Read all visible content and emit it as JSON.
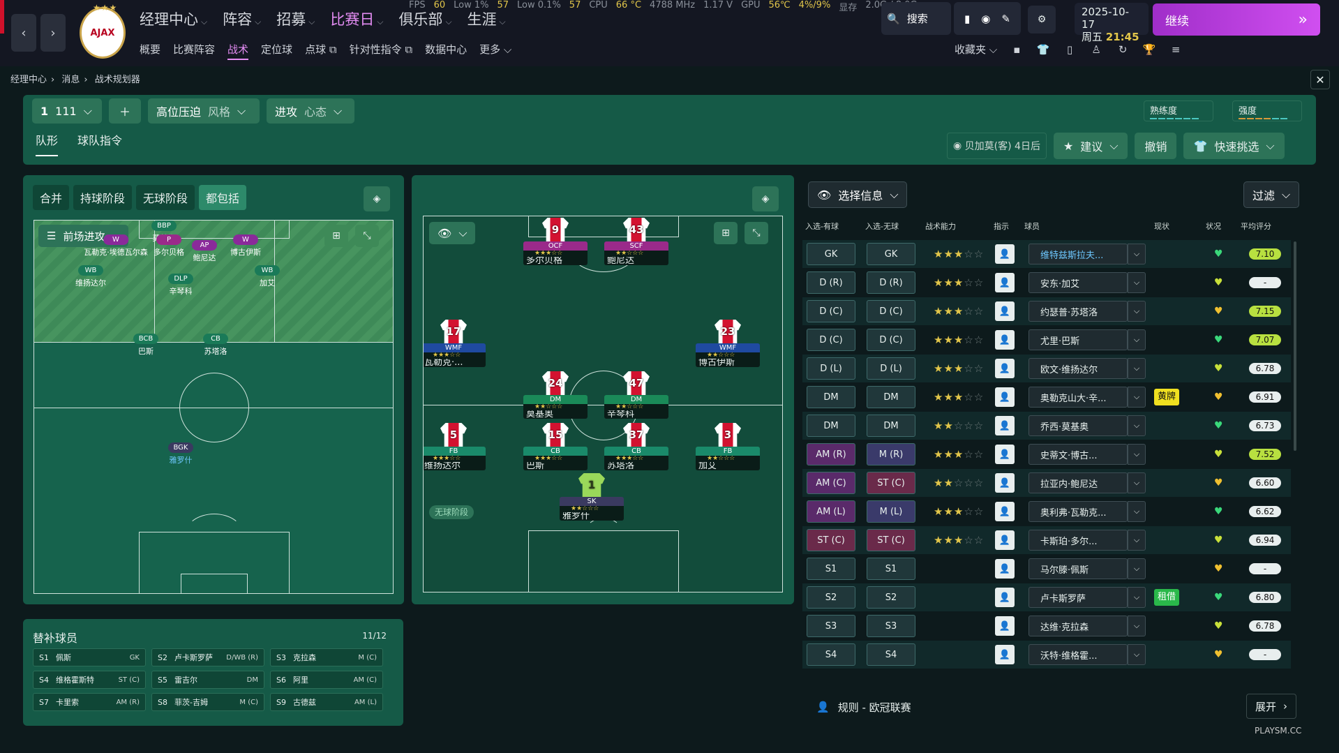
{
  "stats": {
    "fps_label": "FPS",
    "fps": "60",
    "low1_label": "Low 1%",
    "low1": "57",
    "low01_label": "Low 0.1%",
    "low01": "57",
    "cpu_label": "CPU",
    "cpu_temp": "66 °C",
    "cpu_freq": "4788 MHz",
    "volt": "1.17 V",
    "gpu_label": "GPU",
    "gpu_temp": "56℃",
    "gpu_pct": "4%/9%",
    "vram_label": "显存",
    "vram": "2.0G / 8.0G"
  },
  "nav": {
    "main": [
      "经理中心",
      "阵容",
      "招募",
      "比赛日",
      "俱乐部",
      "生涯"
    ],
    "sub": [
      "概要",
      "比赛阵容",
      "战术",
      "定位球",
      "点球",
      "针对性指令",
      "数据中心",
      "更多"
    ],
    "club_logo": "AJAX"
  },
  "top": {
    "search": "搜索",
    "date": "2025-10-17",
    "weekday": "周五",
    "time": "21:45",
    "continue": "继续",
    "favorites": "收藏夹"
  },
  "breadcrumb": [
    "经理中心",
    "消息",
    "战术规划器"
  ],
  "tactic": {
    "slot": "1",
    "formation_code": "111",
    "style_value": "高位压迫",
    "style_label": "风格",
    "mentality_value": "进攻",
    "mentality_label": "心态",
    "familiarity": "熟练度",
    "intensity": "强度"
  },
  "tabs": [
    "队形",
    "球队指令"
  ],
  "opponent": {
    "text": "贝加莫(客) 4日后",
    "suggest": "建议",
    "undo": "撤销",
    "quick_pick": "快速挑选"
  },
  "left_panel": {
    "phases": [
      "合并",
      "持球阶段",
      "无球阶段",
      "都包括"
    ],
    "view_select": "前场进攻",
    "tags": [
      {
        "role": "BBP",
        "name": "莫基奥"
      },
      {
        "role": "W",
        "name": "瓦勒克·埃德瓦尔森"
      },
      {
        "role": "P",
        "name": "多尔贝格"
      },
      {
        "role": "AP",
        "name": "鲍尼达"
      },
      {
        "role": "W",
        "name": "博古伊斯"
      },
      {
        "role": "WB",
        "name": "维扬达尔"
      },
      {
        "role": "DLP",
        "name": "辛琴科"
      },
      {
        "role": "WB",
        "name": "加艾"
      },
      {
        "role": "BCB",
        "name": "巴斯"
      },
      {
        "role": "CB",
        "name": "苏塔洛"
      },
      {
        "role": "BGK",
        "name": "雅罗什"
      }
    ]
  },
  "mid_panel": {
    "phase_label": "无球阶段",
    "players": [
      {
        "no": "9",
        "role": "OCF",
        "name": "多尔贝格",
        "stars": "★★★☆☆"
      },
      {
        "no": "43",
        "role": "SCF",
        "name": "鲍尼达",
        "stars": "★★☆☆☆"
      },
      {
        "no": "17",
        "role": "WMF",
        "name": "瓦勒克·...",
        "stars": "★★★☆☆"
      },
      {
        "no": "23",
        "role": "WMF",
        "name": "博古伊斯",
        "stars": "★★☆☆☆"
      },
      {
        "no": "24",
        "role": "DM",
        "name": "莫基奥",
        "stars": "★★☆☆☆"
      },
      {
        "no": "47",
        "role": "DM",
        "name": "辛琴科",
        "stars": "★★☆☆☆"
      },
      {
        "no": "5",
        "role": "FB",
        "name": "维扬达尔",
        "stars": "★★★☆☆"
      },
      {
        "no": "15",
        "role": "CB",
        "name": "巴斯",
        "stars": "★★★☆☆"
      },
      {
        "no": "37",
        "role": "CB",
        "name": "苏塔洛",
        "stars": "★★★☆☆"
      },
      {
        "no": "3",
        "role": "FB",
        "name": "加艾",
        "stars": "★★☆☆☆"
      },
      {
        "no": "1",
        "role": "SK",
        "name": "雅罗什",
        "stars": "★★☆☆☆"
      }
    ]
  },
  "subs": {
    "title": "替补球员",
    "count": "11/12",
    "items": [
      {
        "slot": "S1",
        "name": "佩斯",
        "pos": "GK"
      },
      {
        "slot": "S2",
        "name": "卢卡斯罗萨",
        "pos": "D/WB (R)"
      },
      {
        "slot": "S3",
        "name": "克拉森",
        "pos": "M (C)"
      },
      {
        "slot": "S4",
        "name": "维格霍斯特",
        "pos": "ST (C)"
      },
      {
        "slot": "S5",
        "name": "雷吉尔",
        "pos": "DM"
      },
      {
        "slot": "S6",
        "name": "阿里",
        "pos": "AM (C)"
      },
      {
        "slot": "S7",
        "name": "卡里索",
        "pos": "AM (R)"
      },
      {
        "slot": "S8",
        "name": "菲茨-吉姆",
        "pos": "M (C)"
      },
      {
        "slot": "S9",
        "name": "古德兹",
        "pos": "AM (L)"
      }
    ]
  },
  "list": {
    "select_info": "选择信息",
    "filter": "过滤",
    "headers": [
      "入选-有球",
      "入选-无球",
      "战术能力",
      "指示",
      "球员",
      "现状",
      "状况",
      "平均评分"
    ],
    "rows": [
      {
        "ip": "GK",
        "op": "GK",
        "stars": "★★★",
        "estars": "☆☆",
        "player": "维特兹斯拉夫...",
        "badge": "",
        "rating": "7.10",
        "heart": "♥"
      },
      {
        "ip": "D (R)",
        "op": "D (R)",
        "stars": "★★★",
        "estars": "☆☆",
        "player": "安东·加艾",
        "badge": "",
        "rating": "-",
        "heart": "♥"
      },
      {
        "ip": "D (C)",
        "op": "D (C)",
        "stars": "★★★",
        "estars": "☆☆",
        "player": "约瑟普·苏塔洛",
        "badge": "",
        "rating": "7.15",
        "heart": "♥"
      },
      {
        "ip": "D (C)",
        "op": "D (C)",
        "stars": "★★★",
        "estars": "☆☆",
        "player": "尤里·巴斯",
        "badge": "",
        "rating": "7.07",
        "heart": "♥"
      },
      {
        "ip": "D (L)",
        "op": "D (L)",
        "stars": "★★★",
        "estars": "☆☆",
        "player": "欧文·维扬达尔",
        "badge": "",
        "rating": "6.78",
        "heart": "♥"
      },
      {
        "ip": "DM",
        "op": "DM",
        "stars": "★★★",
        "estars": "☆☆",
        "player": "奥勒克山大·辛...",
        "badge": "黄牌",
        "rating": "6.91",
        "heart": "♥"
      },
      {
        "ip": "DM",
        "op": "DM",
        "stars": "★★",
        "estars": "☆☆☆",
        "player": "乔西·莫基奥",
        "badge": "",
        "rating": "6.73",
        "heart": "♥"
      },
      {
        "ip": "AM (R)",
        "op": "M (R)",
        "stars": "★★★",
        "estars": "☆☆",
        "player": "史蒂文·博古...",
        "badge": "",
        "rating": "7.52",
        "heart": "♥"
      },
      {
        "ip": "AM (C)",
        "op": "ST (C)",
        "stars": "★★",
        "estars": "☆☆☆",
        "player": "拉亚内·鲍尼达",
        "badge": "",
        "rating": "6.60",
        "heart": "♥"
      },
      {
        "ip": "AM (L)",
        "op": "M (L)",
        "stars": "★★★",
        "estars": "☆☆",
        "player": "奥利弗·瓦勒克...",
        "badge": "",
        "rating": "6.62",
        "heart": "♥"
      },
      {
        "ip": "ST (C)",
        "op": "ST (C)",
        "stars": "★★★",
        "estars": "☆☆",
        "player": "卡斯珀·多尔...",
        "badge": "",
        "rating": "6.94",
        "heart": "♥"
      },
      {
        "ip": "S1",
        "op": "S1",
        "stars": "",
        "estars": "",
        "player": "马尔滕·佩斯",
        "badge": "",
        "rating": "-",
        "heart": "♥"
      },
      {
        "ip": "S2",
        "op": "S2",
        "stars": "",
        "estars": "",
        "player": "卢卡斯罗萨",
        "badge": "租借",
        "rating": "6.80",
        "heart": "♥"
      },
      {
        "ip": "S3",
        "op": "S3",
        "stars": "",
        "estars": "",
        "player": "达维·克拉森",
        "badge": "",
        "rating": "6.78",
        "heart": "♥"
      },
      {
        "ip": "S4",
        "op": "S4",
        "stars": "",
        "estars": "",
        "player": "沃特·维格霍...",
        "badge": "",
        "rating": "-",
        "heart": "♥"
      }
    ],
    "footer": "规则 - 欧冠联赛",
    "expand": "展开"
  },
  "watermark": "PLAYSM.CC"
}
